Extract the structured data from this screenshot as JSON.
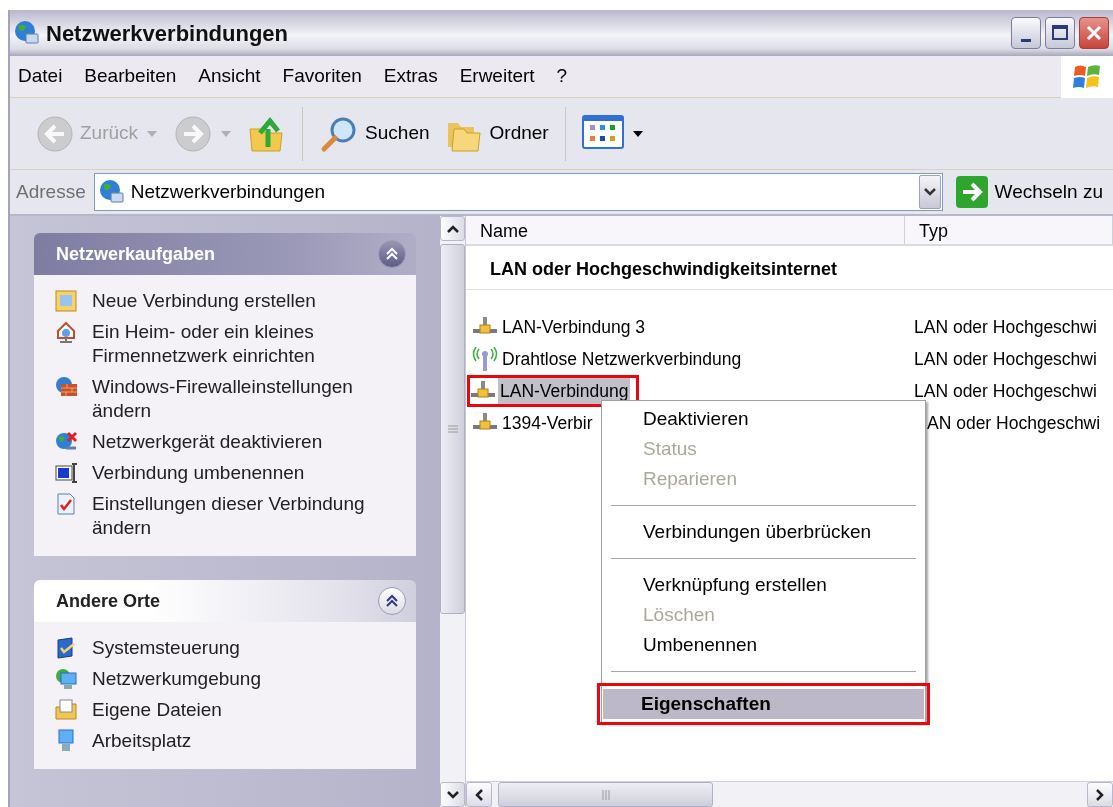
{
  "window": {
    "title": "Netzwerkverbindungen"
  },
  "menu_bar": [
    "Datei",
    "Bearbeiten",
    "Ansicht",
    "Favoriten",
    "Extras",
    "Erweitert",
    "?"
  ],
  "toolbar": [
    {
      "kind": "back",
      "label": "Zurück",
      "disabled": true,
      "dropdown": true
    },
    {
      "kind": "forward",
      "disabled": true,
      "dropdown": true
    },
    {
      "kind": "up",
      "disabled": false,
      "dropdown": false
    },
    {
      "kind": "separator"
    },
    {
      "kind": "search",
      "label": "Suchen",
      "disabled": false,
      "dropdown": false
    },
    {
      "kind": "folders",
      "label": "Ordner",
      "disabled": false,
      "dropdown": false
    },
    {
      "kind": "separator"
    },
    {
      "kind": "views",
      "disabled": false,
      "dropdown": true
    }
  ],
  "address_bar": {
    "label": "Adresse",
    "value": "Netzwerkverbindungen",
    "go_label": "Wechseln zu"
  },
  "task_panes": [
    {
      "title": "Netzwerkaufgaben",
      "kind": "special",
      "expanded": true,
      "items": [
        {
          "kind": "new-connection",
          "label": "Neue Verbindung erstellen"
        },
        {
          "kind": "home-network",
          "label": "Ein Heim- oder ein kleines Firmennetzwerk einrichten"
        },
        {
          "kind": "firewall",
          "label": "Windows-Firewalleinstellungen ändern"
        },
        {
          "kind": "disable-device",
          "label": "Netzwerkgerät deaktivieren"
        },
        {
          "kind": "rename",
          "label": "Verbindung umbenennen"
        },
        {
          "kind": "settings",
          "label": "Einstellungen dieser Verbindung ändern"
        }
      ]
    },
    {
      "title": "Andere Orte",
      "kind": "normal",
      "expanded": true,
      "items": [
        {
          "kind": "control-panel",
          "label": "Systemsteuerung"
        },
        {
          "kind": "network-places",
          "label": "Netzwerkumgebung"
        },
        {
          "kind": "documents",
          "label": "Eigene Dateien"
        },
        {
          "kind": "computer",
          "label": "Arbeitsplatz"
        }
      ]
    }
  ],
  "list": {
    "columns": [
      "Name",
      "Typ"
    ],
    "group": "LAN oder Hochgeschwindigkeitsinternet",
    "rows": [
      {
        "kind": "lan",
        "name": "LAN-Verbindung 3",
        "type": "LAN oder Hochgeschwi",
        "selected": false,
        "highlighted": false
      },
      {
        "kind": "wireless",
        "name": "Drahtlose Netzwerkverbindung",
        "type": "LAN oder Hochgeschwi",
        "selected": false,
        "highlighted": false
      },
      {
        "kind": "lan",
        "name": "LAN-Verbindung",
        "type": "LAN oder Hochgeschwi",
        "selected": true,
        "highlighted": true
      },
      {
        "kind": "lan",
        "name": "1394-Verbir",
        "type": "AN oder Hochgeschwi",
        "selected": false,
        "highlighted": false
      }
    ]
  },
  "context_menu": {
    "items": [
      {
        "kind": "item",
        "label": "Deaktivieren",
        "disabled": false,
        "default": false,
        "selected": false,
        "highlighted": false
      },
      {
        "kind": "item",
        "label": "Status",
        "disabled": true,
        "default": false,
        "selected": false,
        "highlighted": false
      },
      {
        "kind": "item",
        "label": "Reparieren",
        "disabled": true,
        "default": false,
        "selected": false,
        "highlighted": false
      },
      {
        "kind": "separator"
      },
      {
        "kind": "item",
        "label": "Verbindungen überbrücken",
        "disabled": false,
        "default": false,
        "selected": false,
        "highlighted": false
      },
      {
        "kind": "separator"
      },
      {
        "kind": "item",
        "label": "Verknüpfung erstellen",
        "disabled": false,
        "default": false,
        "selected": false,
        "highlighted": false
      },
      {
        "kind": "item",
        "label": "Löschen",
        "disabled": true,
        "default": false,
        "selected": false,
        "highlighted": false
      },
      {
        "kind": "item",
        "label": "Umbenennen",
        "disabled": false,
        "default": false,
        "selected": false,
        "highlighted": false
      },
      {
        "kind": "separator"
      },
      {
        "kind": "item",
        "label": "Eigenschaften",
        "disabled": false,
        "default": true,
        "selected": true,
        "highlighted": true
      }
    ]
  }
}
